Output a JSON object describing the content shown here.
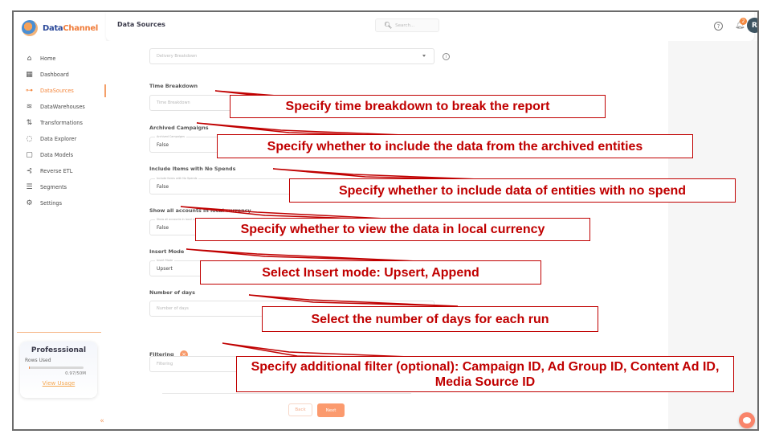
{
  "app": {
    "brand_part1": "Data",
    "brand_part2": "Channel",
    "brand_colors": {
      "primary": "#2d4a9a",
      "accent": "#f07c3a"
    }
  },
  "sidebar": {
    "items": [
      {
        "label": "Home",
        "icon": "home-icon",
        "active": false
      },
      {
        "label": "Dashboard",
        "icon": "dashboard-icon",
        "active": false
      },
      {
        "label": "DataSources",
        "icon": "datasources-icon",
        "active": true
      },
      {
        "label": "DataWarehouses",
        "icon": "database-icon",
        "active": false
      },
      {
        "label": "Transformations",
        "icon": "transform-icon",
        "active": false
      },
      {
        "label": "Data Explorer",
        "icon": "explorer-icon",
        "active": false
      },
      {
        "label": "Data Models",
        "icon": "models-icon",
        "active": false
      },
      {
        "label": "Reverse ETL",
        "icon": "reverse-etl-icon",
        "active": false
      },
      {
        "label": "Segments",
        "icon": "segments-icon",
        "active": false
      },
      {
        "label": "Settings",
        "icon": "gear-icon",
        "active": false
      }
    ],
    "plan": {
      "title": "Professsional",
      "rows_label": "Rows Used",
      "usage_text": "0.97/50M",
      "usage_fraction": 0.019,
      "link": "View Usage"
    },
    "collapse_icon": "«"
  },
  "header": {
    "title": "Data Sources",
    "search_placeholder": "Search...",
    "notification_count": "2",
    "avatar_initial": "R"
  },
  "form": {
    "delivery_breakdown": {
      "placeholder": "Delivery Breakdown"
    },
    "time_breakdown": {
      "label": "Time Breakdown",
      "placeholder": "Time Breakdown"
    },
    "archived_campaigns": {
      "label": "Archived Campaigns",
      "float_label": "Archived Campaigns",
      "value": "False"
    },
    "include_no_spends": {
      "label": "Include Items with No Spends",
      "float_label": "Include Items with No Spends",
      "value": "False"
    },
    "local_currency": {
      "label": "Show all accounts in local currency",
      "float_label": "Show all accounts in local currency",
      "value": "False"
    },
    "insert_mode": {
      "label": "Insert Mode",
      "float_label": "Insert Mode",
      "value": "Upsert"
    },
    "number_of_days": {
      "label": "Number of days",
      "placeholder": "Number of days"
    },
    "filtering": {
      "label": "Filtering",
      "placeholder": "Filtering"
    },
    "back_label": "Back",
    "next_label": "Next"
  },
  "callouts": [
    "Specify time breakdown to break the report",
    "Specify whether to  include the data from the archived entities",
    "Specify whether to include data of entities with no spend",
    "Specify whether to view the data in local currency",
    "Select Insert mode: Upsert, Append",
    "Select the number of days for each run",
    "Specify additional filter (optional): Campaign ID, Ad Group ID, Content Ad ID, Media Source ID"
  ],
  "callout_color": "#c00000"
}
